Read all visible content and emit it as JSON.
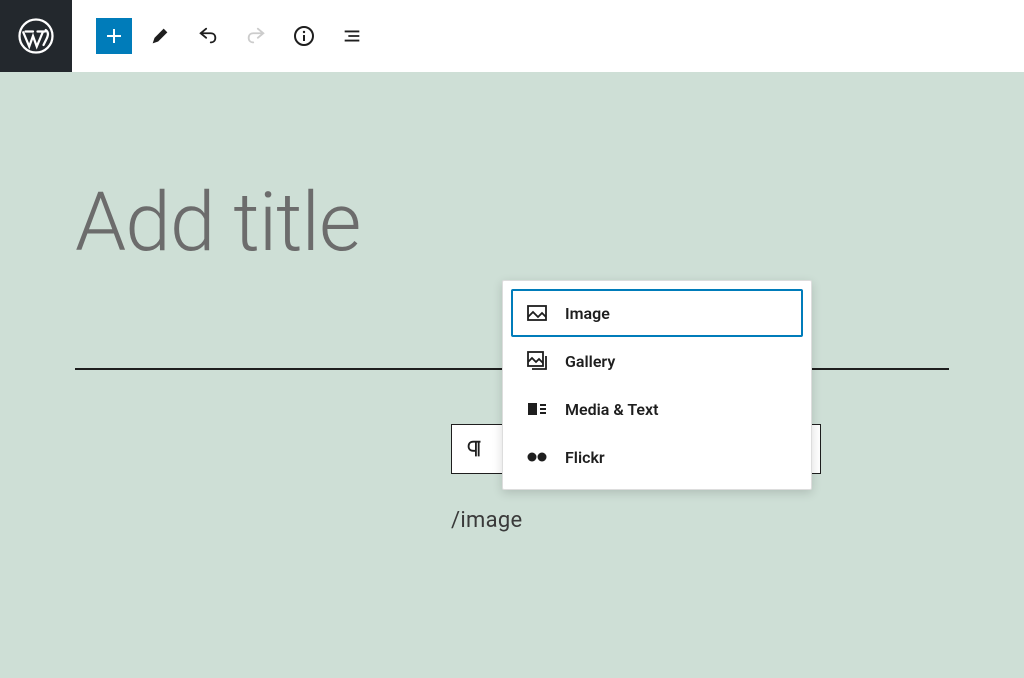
{
  "toolbar": {
    "wordpress_logo": "wordpress",
    "add": "add",
    "edit": "edit",
    "undo": "undo",
    "redo": "redo",
    "info": "info",
    "outline": "outline"
  },
  "editor": {
    "title_placeholder": "Add title",
    "slash_command": "/image"
  },
  "inserter": {
    "items": [
      {
        "label": "Image",
        "icon": "image-icon",
        "selected": true
      },
      {
        "label": "Gallery",
        "icon": "gallery-icon",
        "selected": false
      },
      {
        "label": "Media & Text",
        "icon": "media-text-icon",
        "selected": false
      },
      {
        "label": "Flickr",
        "icon": "flickr-icon",
        "selected": false
      }
    ]
  }
}
